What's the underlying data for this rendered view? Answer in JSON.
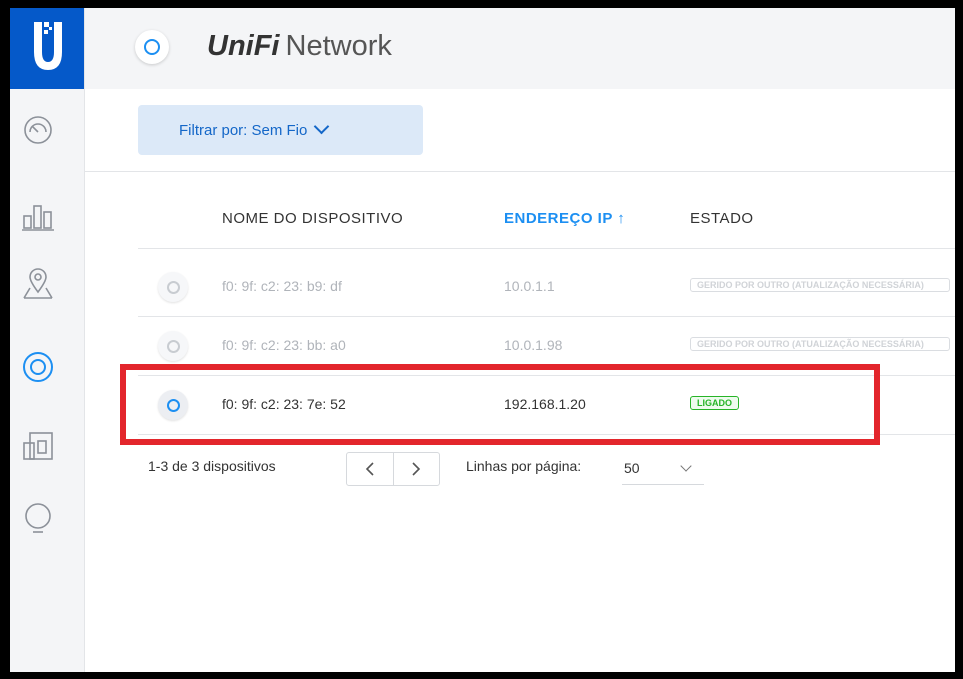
{
  "app": {
    "brand_unifi": "UniFi",
    "brand_network": "Network"
  },
  "sidebar": {
    "items": [
      {
        "icon": "dashboard-icon"
      },
      {
        "icon": "statistics-icon"
      },
      {
        "icon": "map-icon"
      },
      {
        "icon": "devices-icon"
      },
      {
        "icon": "clients-icon"
      },
      {
        "icon": "insights-icon"
      }
    ]
  },
  "filter": {
    "label": "Filtrar por: Sem Fio"
  },
  "table": {
    "columns": {
      "name": "NOME DO DISPOSITIVO",
      "ip": "ENDEREÇO IP ↑",
      "state": "ESTADO"
    },
    "rows": [
      {
        "name": "f0: 9f: c2: 23: b9: df",
        "ip": "10.0.1.1",
        "state": "GERIDO POR OUTRO (ATUALIZAÇÃO NECESSÁRIA)"
      },
      {
        "name": "f0: 9f: c2: 23: bb: a0",
        "ip": "10.0.1.98",
        "state": "GERIDO POR OUTRO (ATUALIZAÇÃO NECESSÁRIA)"
      },
      {
        "name": "f0: 9f: c2: 23: 7e: 52",
        "ip": "192.168.1.20",
        "state": "LIGADO"
      }
    ]
  },
  "pager": {
    "count": "1-3 de 3 dispositivos",
    "rows_label": "Linhas por página:",
    "rows_value": "50"
  },
  "colors": {
    "accent": "#1c8ff2",
    "logo": "#0559c9",
    "highlight": "#e3262c",
    "ok": "#27b427"
  }
}
